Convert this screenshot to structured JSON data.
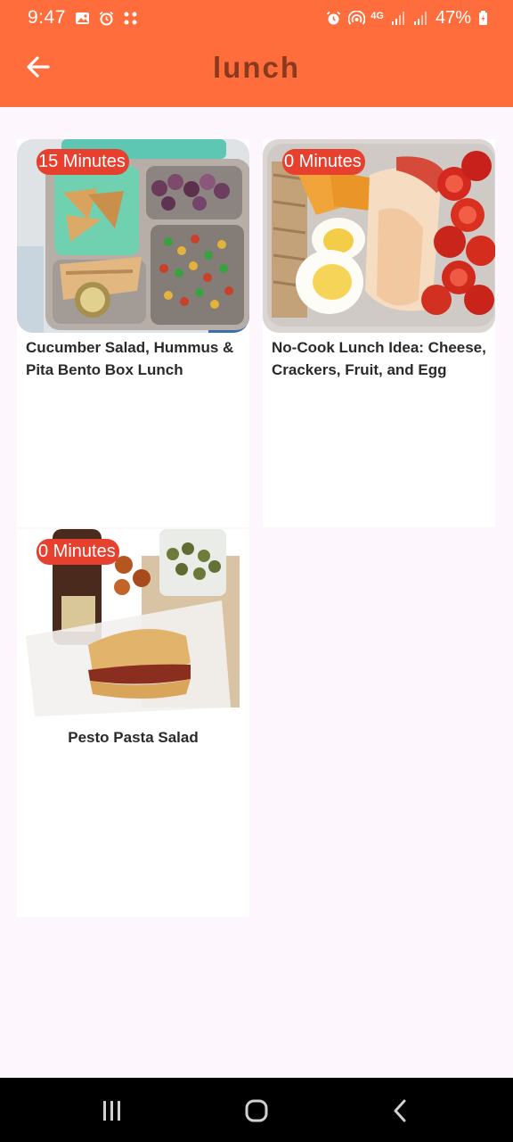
{
  "status_bar": {
    "time": "9:47",
    "battery": "47%",
    "network": "4G",
    "left_icons": [
      "image-icon",
      "alarm-icon",
      "grid-dots-icon"
    ],
    "right_icons": [
      "alarm-icon",
      "hotspot-icon",
      "signal-icon",
      "signal-icon",
      "battery-icon"
    ]
  },
  "app_bar": {
    "title": "lunch",
    "back_icon": "arrow-left-icon",
    "background": "#ff6d3d",
    "title_color": "#8a3a1c"
  },
  "recipes": [
    {
      "time": "15 Minutes",
      "title": "Cucumber Salad, Hummus & Pita Bento Box Lunch"
    },
    {
      "time": "0 Minutes",
      "title": "No-Cook Lunch Idea: Cheese, Crackers, Fruit, and Egg"
    },
    {
      "time": "0 Minutes",
      "title": "Pesto Pasta Salad"
    }
  ],
  "nav_bar": {
    "icons": [
      "recent-apps-icon",
      "home-icon",
      "back-nav-icon"
    ]
  },
  "colors": {
    "accent": "#ff6d3d",
    "badge": "#e8402f",
    "background": "#fdf6fd"
  }
}
